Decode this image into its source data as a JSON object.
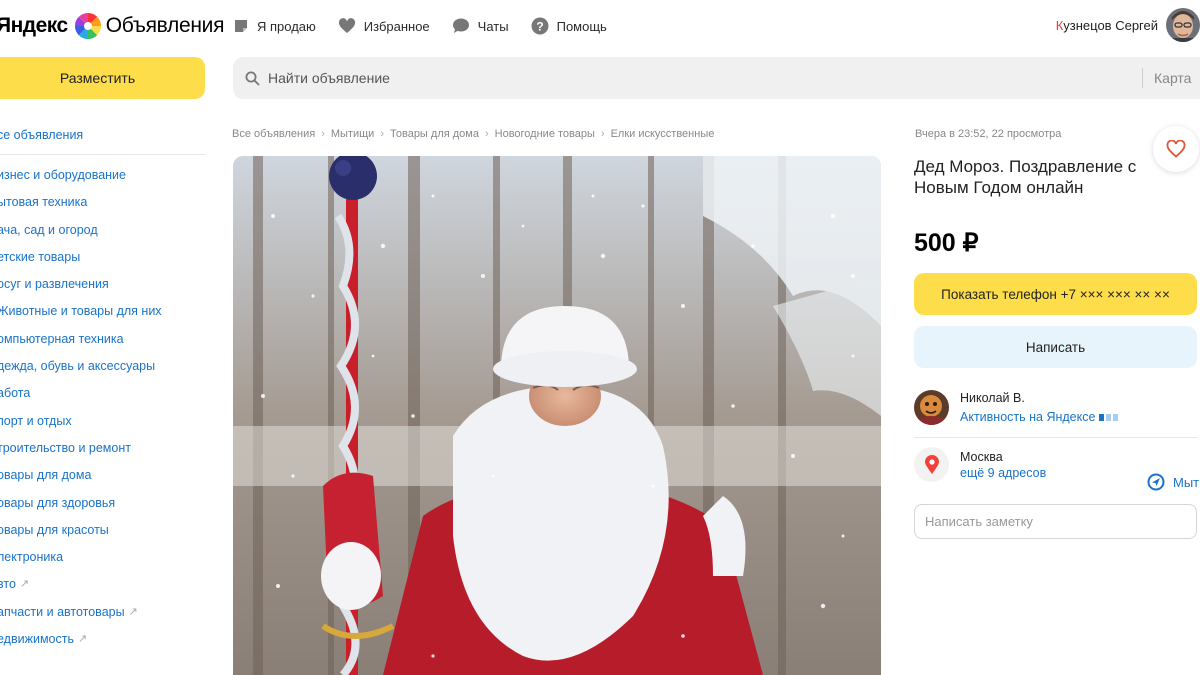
{
  "header": {
    "logo_brand": "Яндекс",
    "logo_product": "Объявления",
    "nav": [
      {
        "label": "Я продаю",
        "icon": "card-icon"
      },
      {
        "label": "Избранное",
        "icon": "heart-icon"
      },
      {
        "label": "Чаты",
        "icon": "chat-icon"
      },
      {
        "label": "Помощь",
        "icon": "help-icon"
      },
      {
        "label": "Мытищи",
        "icon": "location-icon"
      }
    ],
    "user_initial": "К",
    "user_rest": "узнецов Сергей"
  },
  "post_button": "Разместить",
  "search": {
    "placeholder": "Найти объявление",
    "map_label": "Карта"
  },
  "sidebar": {
    "all_label": "се объявления",
    "categories": [
      {
        "label": "изнес и оборудование",
        "external": false
      },
      {
        "label": "ытовая техника",
        "external": false
      },
      {
        "label": "ача, сад и огород",
        "external": false
      },
      {
        "label": "етские товары",
        "external": false
      },
      {
        "label": "осуг и развлечения",
        "external": false
      },
      {
        "label": "Животные и товары для них",
        "external": false
      },
      {
        "label": "омпьютерная техника",
        "external": false
      },
      {
        "label": "дежда, обувь и аксессуары",
        "external": false
      },
      {
        "label": "абота",
        "external": false
      },
      {
        "label": "порт и отдых",
        "external": false
      },
      {
        "label": "троительство и ремонт",
        "external": false
      },
      {
        "label": "овары для дома",
        "external": false
      },
      {
        "label": "овары для здоровья",
        "external": false
      },
      {
        "label": "овары для красоты",
        "external": false
      },
      {
        "label": "лектроника",
        "external": false
      },
      {
        "label": "вто",
        "external": true
      },
      {
        "label": "апчасти и автотовары",
        "external": true
      },
      {
        "label": "едвижимость",
        "external": true
      }
    ]
  },
  "breadcrumbs": [
    "Все объявления",
    "Мытищи",
    "Товары для дома",
    "Новогодние товары",
    "Елки искусственные"
  ],
  "listing": {
    "meta": "Вчера в 23:52, 22 просмотра",
    "title": "Дед Мороз. Поздравление с Новым Годом онлайн",
    "price": "500 ₽",
    "phone_button": "Показать телефон +7 ××× ××× ×× ××",
    "write_button": "Написать"
  },
  "seller": {
    "name": "Николай В.",
    "activity": "Активность на Яндексе",
    "activity_level": 0.33
  },
  "location": {
    "city": "Москва",
    "more": "ещё 9 адресов"
  },
  "note": {
    "placeholder": "Написать заметку"
  },
  "colors": {
    "accent_yellow": "#fedd4b",
    "link_blue": "#1a73c9",
    "light_blue": "#e7f4fc"
  }
}
